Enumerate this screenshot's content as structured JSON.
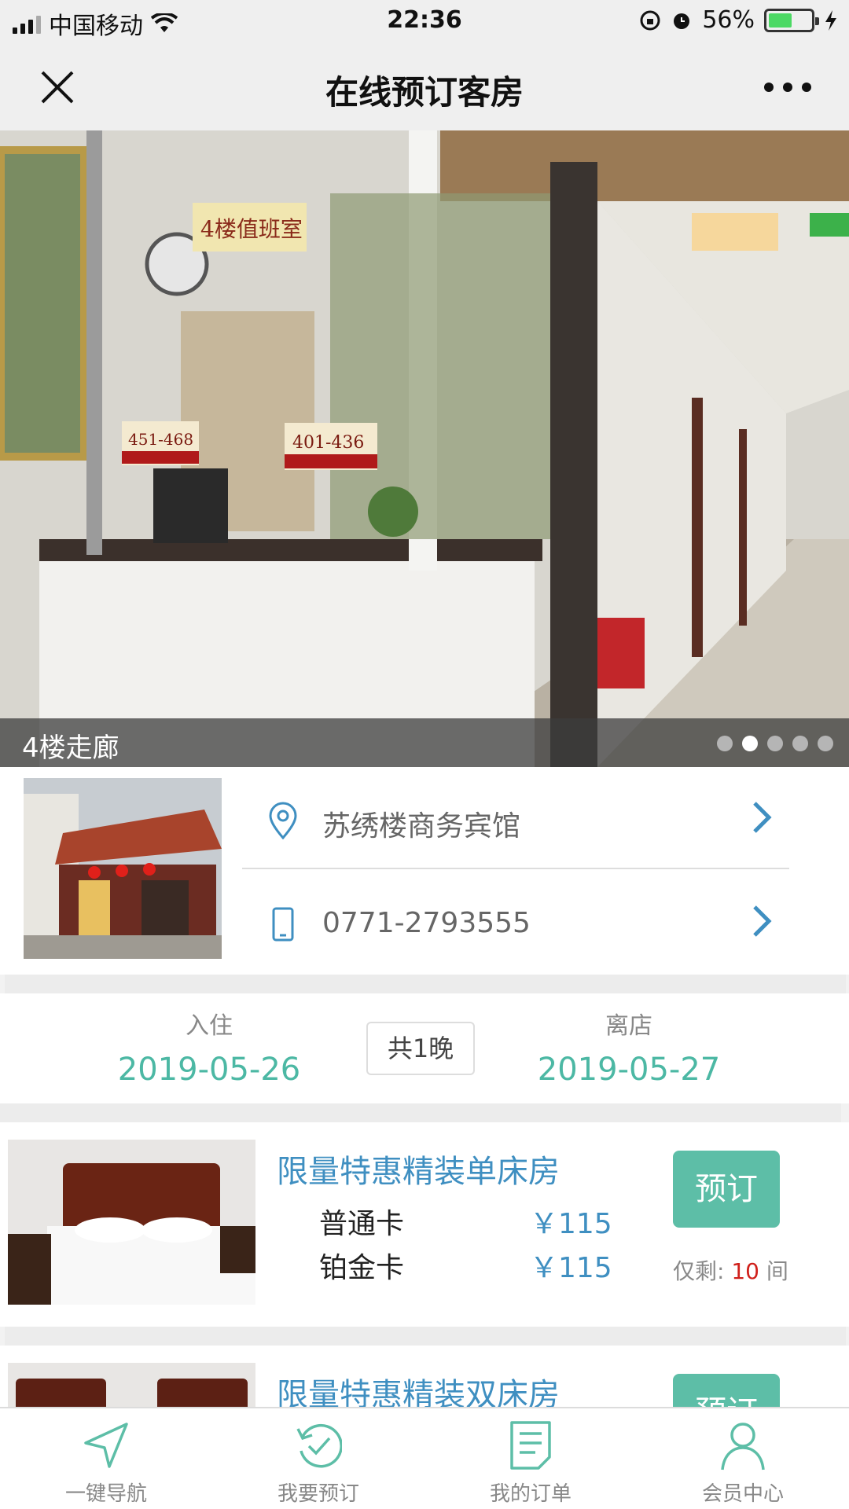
{
  "status_bar": {
    "carrier": "中国移动",
    "time": "22:36",
    "battery": "56%"
  },
  "nav": {
    "title": "在线预订客房"
  },
  "hero": {
    "caption": "4楼走廊",
    "sign_duty_room": "4楼值班室",
    "sign_rooms_left": "451-468",
    "sign_rooms_right": "401-436",
    "slide_count": 5,
    "active_slide": 2
  },
  "hotel": {
    "name": "苏绣楼商务宾馆",
    "phone": "0771-2793555"
  },
  "stay": {
    "checkin_label": "入住",
    "checkin_date": "2019-05-26",
    "nights": "共1晚",
    "checkout_label": "离店",
    "checkout_date": "2019-05-27"
  },
  "rooms": [
    {
      "name": "限量特惠精装单床房",
      "prices": [
        {
          "card": "普通卡",
          "price": "￥115"
        },
        {
          "card": "铂金卡",
          "price": "￥115"
        }
      ],
      "book_label": "预订",
      "remain_prefix": "仅剩:",
      "remain_count": "10",
      "remain_suffix": "间"
    },
    {
      "name": "限量特惠精装双床房",
      "book_label": "预订"
    }
  ],
  "tabbar": {
    "items": [
      {
        "label": "一键导航",
        "icon": "navigation-arrow-icon"
      },
      {
        "label": "我要预订",
        "icon": "refresh-check-icon"
      },
      {
        "label": "我的订单",
        "icon": "order-document-icon"
      },
      {
        "label": "会员中心",
        "icon": "user-icon"
      }
    ]
  },
  "colors": {
    "accent": "#5dbea7",
    "date_text": "#4cb8a4",
    "link_blue": "#3f8fc1",
    "remain_red": "#d0201b"
  }
}
